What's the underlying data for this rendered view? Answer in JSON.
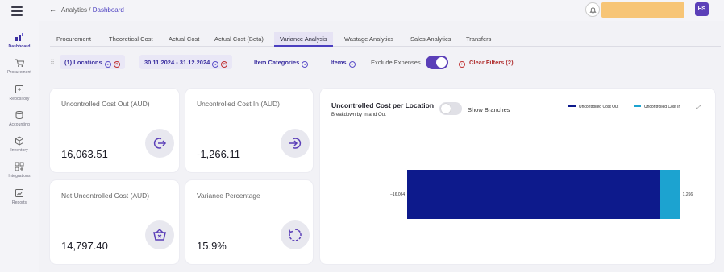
{
  "sidebar": {
    "items": [
      {
        "label": "Dashboard",
        "icon": "dashboard-icon"
      },
      {
        "label": "Procurement",
        "icon": "cart-icon"
      },
      {
        "label": "Repository",
        "icon": "repository-icon"
      },
      {
        "label": "Accounting",
        "icon": "accounting-icon"
      },
      {
        "label": "Inventory",
        "icon": "inventory-icon"
      },
      {
        "label": "Integrations",
        "icon": "integrations-icon"
      },
      {
        "label": "Reports",
        "icon": "reports-icon"
      }
    ]
  },
  "header": {
    "back_glyph": "←",
    "breadcrumb_root": "Analytics",
    "breadcrumb_sep": "/",
    "breadcrumb_current": "Dashboard",
    "user_initials": "HS"
  },
  "tabs": [
    "Procurement",
    "Theoretical Cost",
    "Actual Cost",
    "Actual Cost (Beta)",
    "Variance Analysis",
    "Wastage Analytics",
    "Sales Analytics",
    "Transfers"
  ],
  "filters": {
    "locations": "(1) Locations",
    "date_range": "30.11.2024 - 31.12.2024",
    "item_categories": "Item Categories",
    "items": "Items",
    "exclude_expenses": "Exclude Expenses",
    "clear_filters": "Clear Filters (2)"
  },
  "kpis": [
    {
      "title": "Uncontrolled Cost Out (AUD)",
      "value": "16,063.51",
      "icon": "arrow-out-icon"
    },
    {
      "title": "Uncontrolled Cost In (AUD)",
      "value": "-1,266.11",
      "icon": "arrow-in-icon"
    },
    {
      "title": "Net Uncontrolled Cost (AUD)",
      "value": "14,797.40",
      "icon": "basket-icon"
    },
    {
      "title": "Variance Percentage",
      "value": "15.9%",
      "icon": "refresh-icon"
    }
  ],
  "chart": {
    "title": "Uncontrolled Cost per Location",
    "subtitle": "Breakdown by In and Out",
    "show_branches": "Show Branches"
  },
  "colors": {
    "accent": "#5b3fb8",
    "out_series": "#0d1a8c",
    "in_series": "#1ca3d0"
  },
  "chart_data": {
    "type": "bar",
    "orientation": "horizontal",
    "series": [
      {
        "name": "Uncontrolled Cost Out",
        "values": [
          -16064
        ],
        "label": "−16,064",
        "color": "#0d1a8c"
      },
      {
        "name": "Uncontrolled Cost In",
        "values": [
          1266
        ],
        "label": "1,266",
        "color": "#1ca3d0"
      }
    ],
    "legend_position": "top-right",
    "grid": false
  }
}
